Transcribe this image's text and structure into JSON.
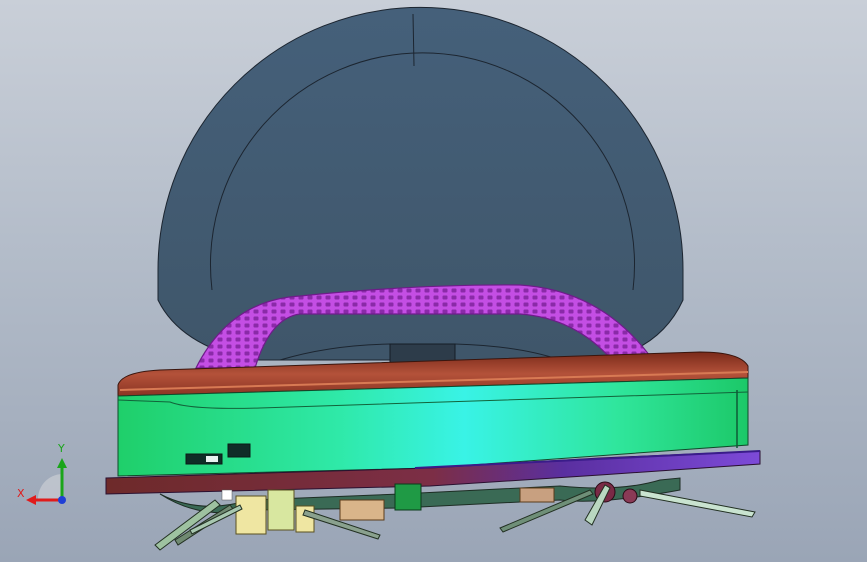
{
  "triad": {
    "x_label": "X",
    "y_label": "Y",
    "x_color": "#e01b1b",
    "y_color": "#1aa51a",
    "z_color": "#1f3fd6"
  },
  "colors": {
    "background_top": "#c9cfd8",
    "background_bottom": "#9aa5b6",
    "dustbin": "#445c71",
    "handle": "#c04ae0",
    "body_band": "#2de88a",
    "body_highlight": "#38f5d8",
    "top_cover": "#a0462e",
    "skirt": "#6a3a8f"
  }
}
